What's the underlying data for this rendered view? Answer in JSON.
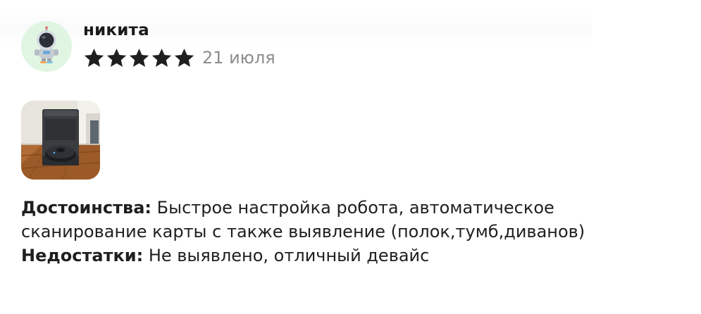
{
  "review": {
    "author": {
      "name": "никита",
      "avatar_icon": "astronaut-avatar-icon"
    },
    "rating": {
      "value": 5,
      "max": 5,
      "star_color": "#1f1f1f"
    },
    "date": "21 июля",
    "photos": [
      {
        "icon": "robot-vacuum-photo"
      }
    ],
    "pros": {
      "label": "Достоинства:",
      "text": "Быстрое настройка робота, автоматическое сканирование карты с также выявление (полок,тумб,диванов)"
    },
    "cons": {
      "label": "Недостатки:",
      "text": "Не выявлено, отличный девайс"
    }
  }
}
